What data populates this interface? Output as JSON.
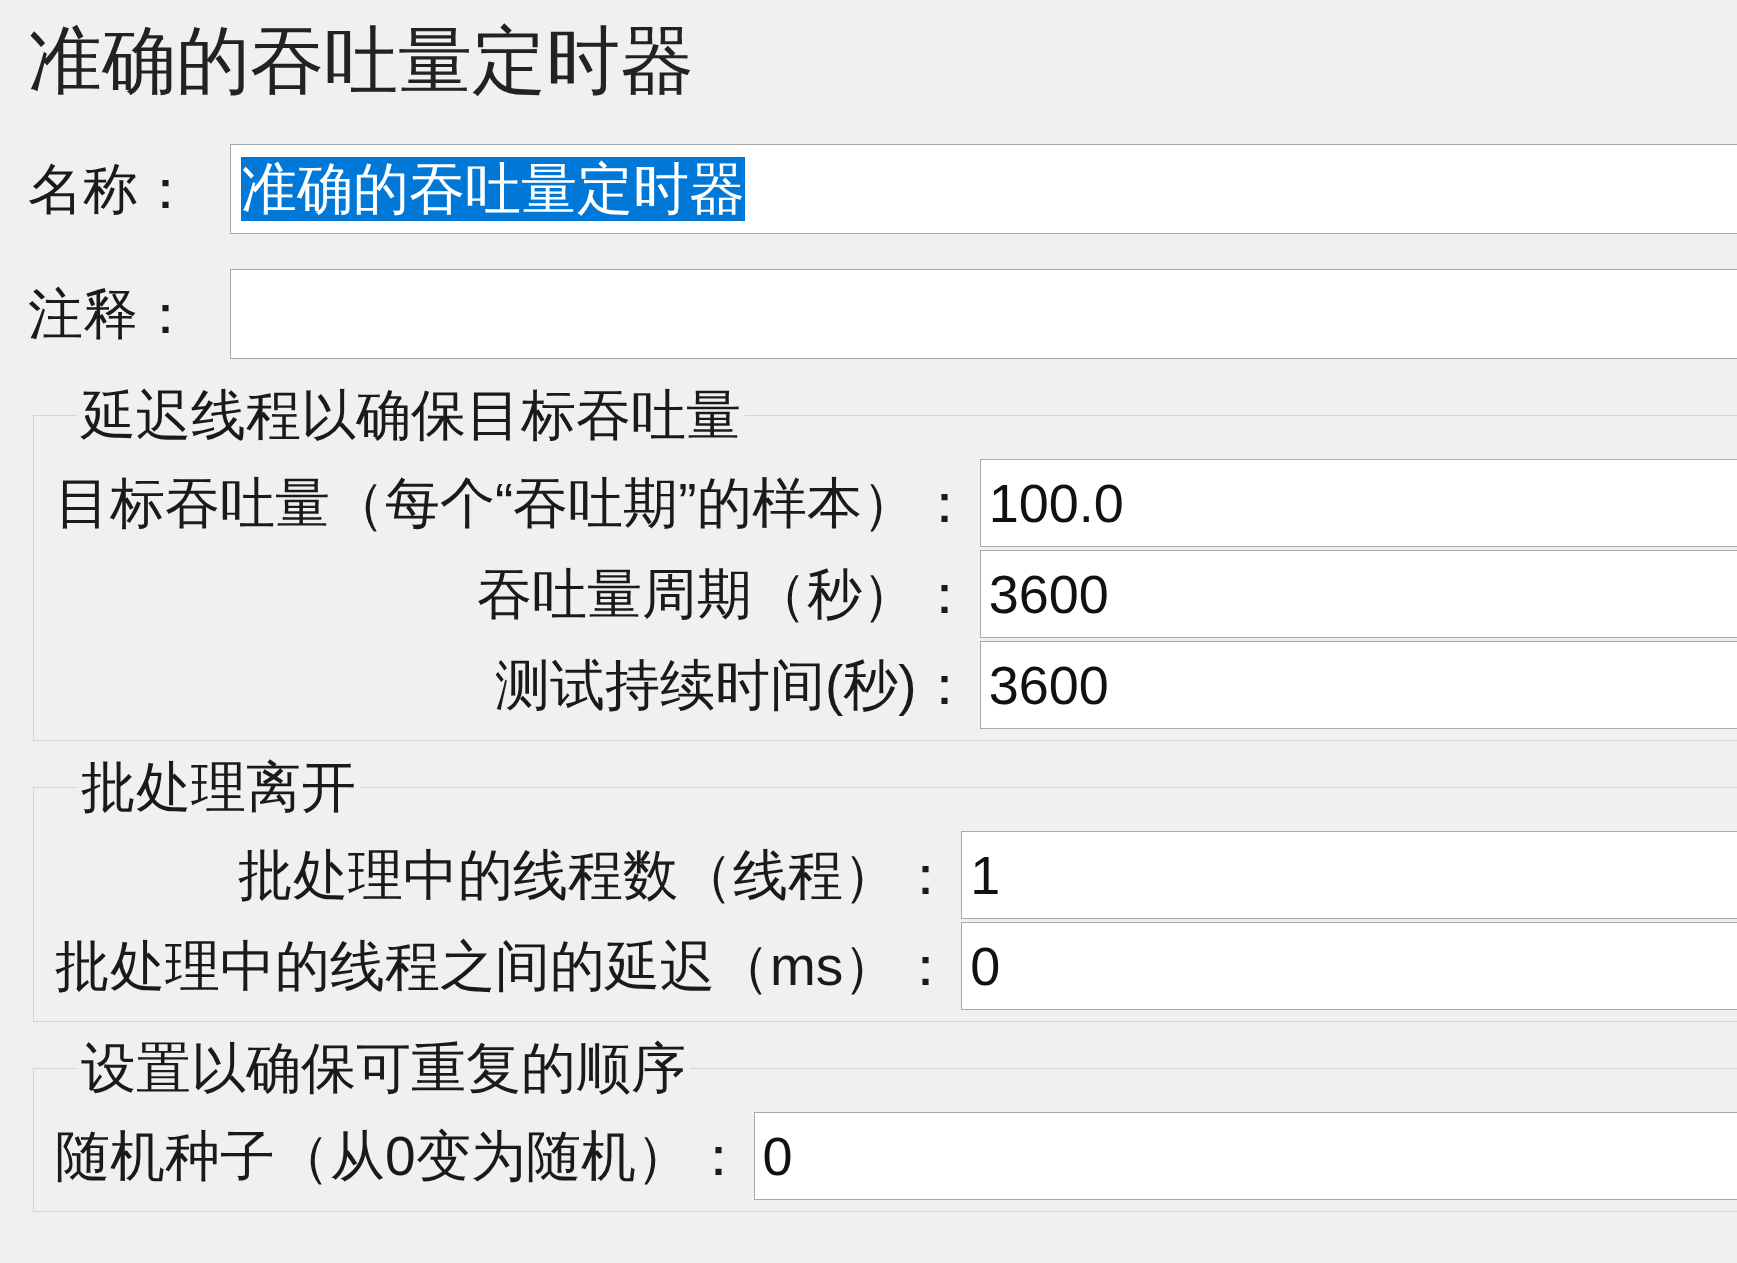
{
  "title": "准确的吞吐量定时器",
  "fields": [
    {
      "label": "名称：",
      "value": "准确的吞吐量定时器",
      "text_selected": true
    },
    {
      "label": "注释："
    }
  ],
  "groups": [
    {
      "title": "延迟线程以确保目标吞吐量",
      "rows": [
        {
          "label": "目标吞吐量（每个“吞吐期”的样本）：",
          "value": "100.0"
        },
        {
          "label": "吞吐量周期（秒）：",
          "value": "3600"
        },
        {
          "label": "测试持续时间(秒)：",
          "value": "3600"
        }
      ]
    },
    {
      "title": "批处理离开",
      "rows": [
        {
          "label": "批处理中的线程数（线程）：",
          "value": "1"
        },
        {
          "label": "批处理中的线程之间的延迟（ms）：",
          "value": "0"
        }
      ]
    },
    {
      "title": "设置以确保可重复的顺序",
      "rows": [
        {
          "label": "随机种子（从0变为随机）：",
          "value": "0"
        }
      ]
    }
  ]
}
